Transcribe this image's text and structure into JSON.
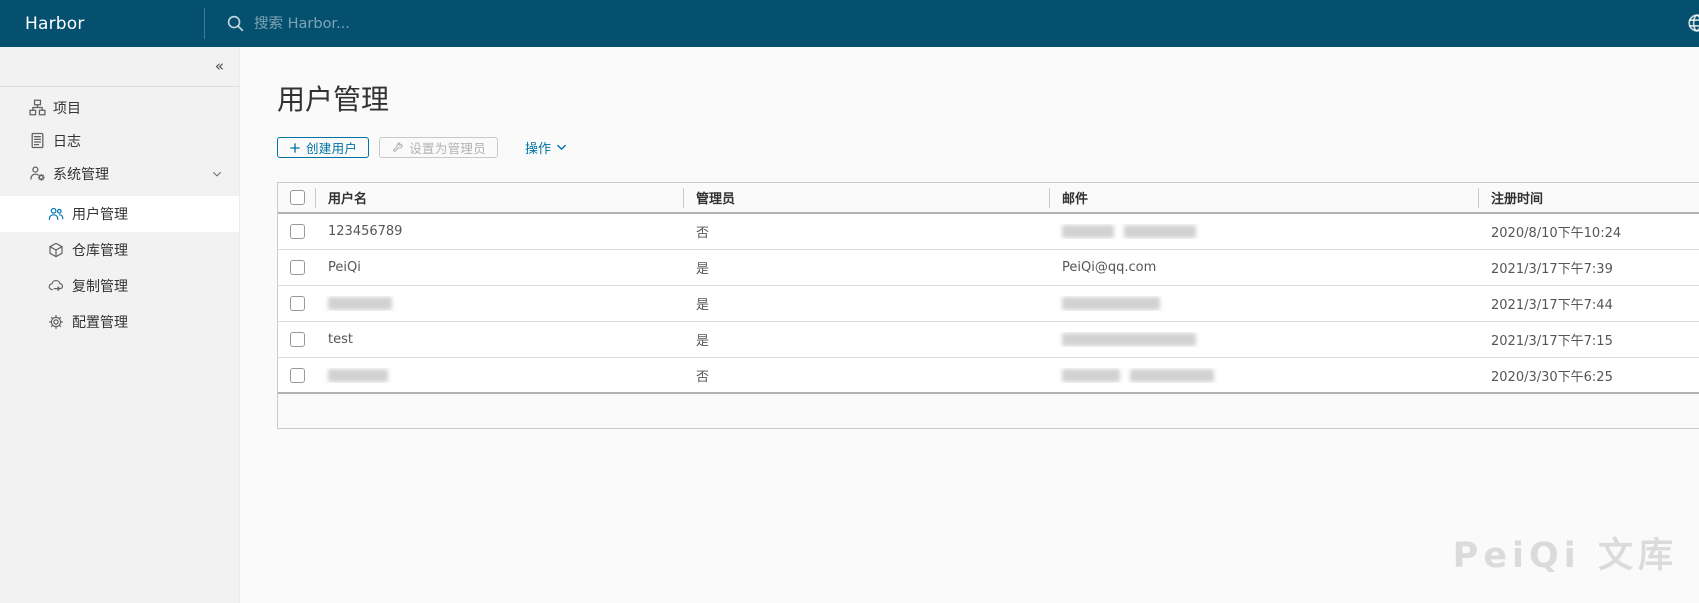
{
  "navbar": {
    "brand": "Harbor",
    "search_placeholder": "搜索 Harbor..."
  },
  "sidebar": {
    "collapse_icon": "«",
    "items": [
      {
        "label": "项目",
        "icon": "sitemap-icon"
      },
      {
        "label": "日志",
        "icon": "log-icon"
      },
      {
        "label": "系统管理",
        "icon": "admin-user-icon",
        "expanded": true,
        "children": [
          {
            "label": "用户管理",
            "icon": "users-icon",
            "active": true
          },
          {
            "label": "仓库管理",
            "icon": "cube-icon"
          },
          {
            "label": "复制管理",
            "icon": "cloud-replication-icon"
          },
          {
            "label": "配置管理",
            "icon": "gear-icon"
          }
        ]
      }
    ]
  },
  "main": {
    "title": "用户管理",
    "toolbar": {
      "create_button": "创建用户",
      "set_admin_button": "设置为管理员",
      "set_admin_disabled": true,
      "actions_label": "操作"
    },
    "table": {
      "columns": [
        "用户名",
        "管理员",
        "邮件",
        "注册时间"
      ],
      "rows": [
        {
          "username": "123456789",
          "admin": "否",
          "email_redact": [
            52,
            72
          ],
          "time": "2020/8/10下午10:24"
        },
        {
          "username": "PeiQi",
          "admin": "是",
          "email": "PeiQi@qq.com",
          "time": "2021/3/17下午7:39"
        },
        {
          "username_redact": [
            64
          ],
          "admin": "是",
          "email_redact": [
            98
          ],
          "time": "2021/3/17下午7:44"
        },
        {
          "username": "test",
          "admin": "是",
          "email_redact": [
            134
          ],
          "time": "2021/3/17下午7:15"
        },
        {
          "username_redact": [
            60
          ],
          "admin": "否",
          "email_redact": [
            58,
            84
          ],
          "time": "2020/3/30下午6:25"
        }
      ]
    }
  },
  "watermark": "PeiQi 文库",
  "colors": {
    "header_bg": "#04506e",
    "accent_blue": "#0072a3",
    "icon_blue": "#0079b8",
    "sidebar_bg": "#f2f2f2",
    "content_bg": "#fafafa",
    "watermark_gray": "#dbdbdb"
  }
}
